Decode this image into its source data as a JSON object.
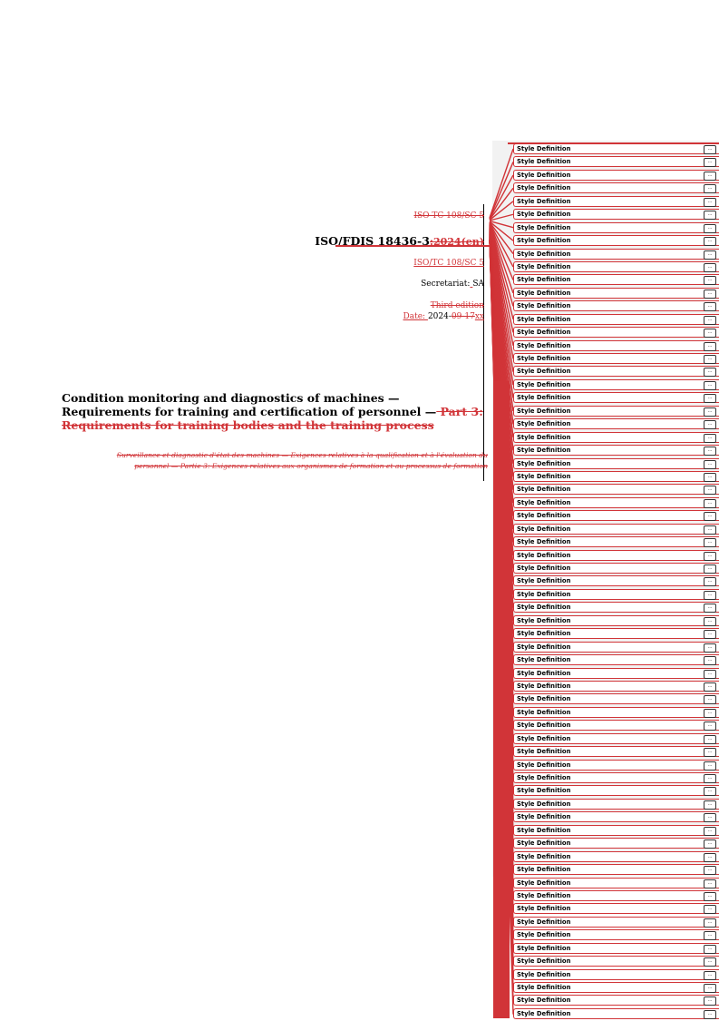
{
  "header": {
    "committee_deleted": "ISO TC 108/SC 5",
    "doc_number": "ISO/FDIS 18436-3",
    "doc_number_deleted_suffix": ":2024(en)",
    "committee_inserted": "ISO/TC 108/SC 5",
    "secretariat_label": "Secretariat:",
    "secretariat_inserted": " ",
    "secretariat_value": "SA",
    "edition_deleted": "Third edition",
    "date_label_inserted": "Date: ",
    "date_year": "2024-",
    "date_deleted": "09-17",
    "date_inserted": "xx"
  },
  "title": {
    "line1": "Condition monitoring and diagnostics of machines —",
    "line2": "Requirements for training and certification of personnel —",
    "part_deleted": " Part 3:",
    "line3_deleted": "Requirements for training bodies and the training process"
  },
  "subtitle_deleted": {
    "line1": "Surveillance et diagnostic d'état des machines — Exigences relatives à la qualification et à l'évaluation du",
    "line2": "personnel — Partie 3: Exigences relatives aux organismes de formation et au processus de formation"
  },
  "comment_balloons": {
    "label": "Style Definition",
    "more_button": "...",
    "count": 67
  },
  "colors": {
    "revision": "#d13438",
    "margin_panel": "#f2f2f2"
  }
}
